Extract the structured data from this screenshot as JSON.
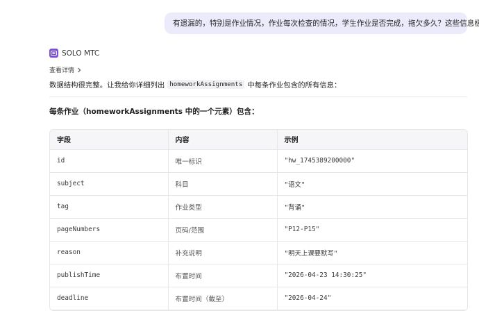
{
  "user_message": "有遗漏的，特别是作业情况，作业每次检查的情况，学生作业是否完成，拖欠多久？这些信息极重要",
  "agent": {
    "name": "SOLO MTC",
    "icon": "agent-chip-icon",
    "accent": "#7b4fd6"
  },
  "details_link": "查看详情",
  "intro": {
    "before": "数据结构很完整。让我给你详细列出",
    "code": "homeworkAssignments",
    "after": "中每条作业包含的所有信息："
  },
  "section_title": "每条作业（homeworkAssignments 中的一个元素）包含：",
  "table": {
    "headers": [
      "字段",
      "内容",
      "示例"
    ],
    "rows": [
      [
        "id",
        "唯一标识",
        "\"hw_1745389200000\""
      ],
      [
        "subject",
        "科目",
        "\"语文\""
      ],
      [
        "tag",
        "作业类型",
        "\"背诵\""
      ],
      [
        "pageNumbers",
        "页码/范围",
        "\"P12-P15\""
      ],
      [
        "reason",
        "补充说明",
        "\"明天上课要默写\""
      ],
      [
        "publishTime",
        "布置时间",
        "\"2026-04-23 14:30:25\""
      ],
      [
        "deadline",
        "布置时间（截至）",
        "\"2026-04-24\""
      ]
    ]
  }
}
